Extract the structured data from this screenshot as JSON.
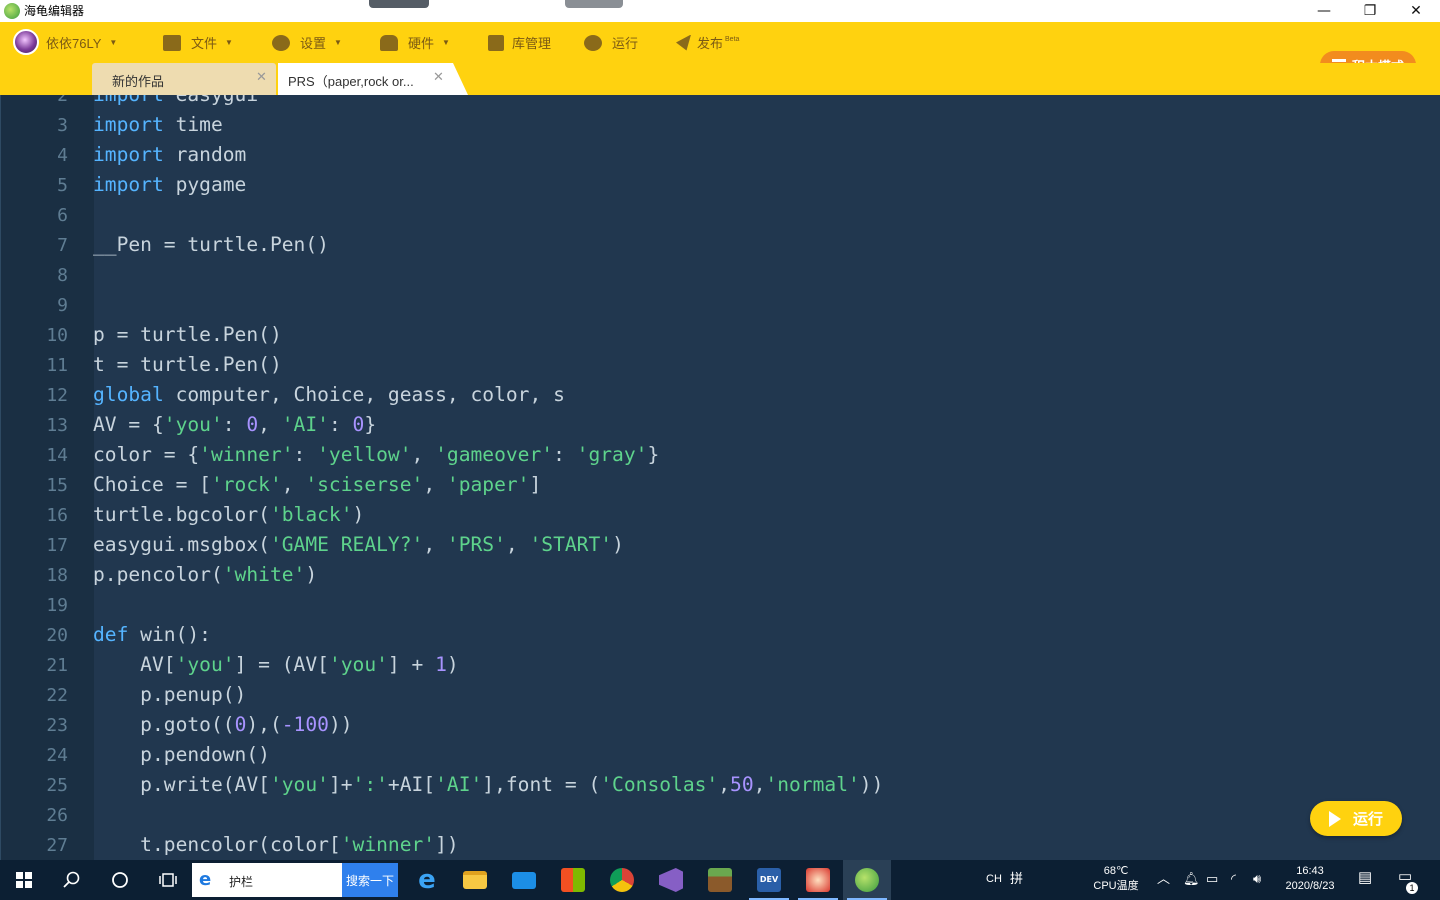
{
  "window": {
    "title": "海龟编辑器",
    "controls": {
      "minimize": "—",
      "maximize": "❐",
      "close": "✕"
    }
  },
  "menu": {
    "user": "依依76LY",
    "file": "文件",
    "settings": "设置",
    "hardware": "硬件",
    "library": "库管理",
    "run": "运行",
    "publish": "发布",
    "publish_badge": "Beta",
    "block_mode": "积木模式"
  },
  "tabs": [
    {
      "label": "新的作品",
      "close": "✕"
    },
    {
      "label": "PRS（paper,rock or...",
      "close": "✕"
    }
  ],
  "editor": {
    "lines": [
      {
        "no": "2",
        "tokens": [
          {
            "t": "import",
            "c": "kw"
          },
          {
            "t": " easygui",
            "c": ""
          }
        ]
      },
      {
        "no": "3",
        "tokens": [
          {
            "t": "import",
            "c": "kw"
          },
          {
            "t": " time",
            "c": ""
          }
        ]
      },
      {
        "no": "4",
        "tokens": [
          {
            "t": "import",
            "c": "kw"
          },
          {
            "t": " random",
            "c": ""
          }
        ]
      },
      {
        "no": "5",
        "tokens": [
          {
            "t": "import",
            "c": "kw"
          },
          {
            "t": " pygame",
            "c": ""
          }
        ]
      },
      {
        "no": "6",
        "tokens": []
      },
      {
        "no": "7",
        "tokens": [
          {
            "t": "__Pen = turtle.Pen()",
            "c": ""
          }
        ]
      },
      {
        "no": "8",
        "tokens": []
      },
      {
        "no": "9",
        "tokens": []
      },
      {
        "no": "10",
        "tokens": [
          {
            "t": "p = turtle.Pen()",
            "c": ""
          }
        ]
      },
      {
        "no": "11",
        "tokens": [
          {
            "t": "t = turtle.Pen()",
            "c": ""
          }
        ]
      },
      {
        "no": "12",
        "tokens": [
          {
            "t": "global",
            "c": "kw"
          },
          {
            "t": " computer, Choice, geass, color, s",
            "c": ""
          }
        ]
      },
      {
        "no": "13",
        "tokens": [
          {
            "t": "AV = {",
            "c": ""
          },
          {
            "t": "'you'",
            "c": "str"
          },
          {
            "t": ": ",
            "c": ""
          },
          {
            "t": "0",
            "c": "num"
          },
          {
            "t": ", ",
            "c": ""
          },
          {
            "t": "'AI'",
            "c": "str"
          },
          {
            "t": ": ",
            "c": ""
          },
          {
            "t": "0",
            "c": "num"
          },
          {
            "t": "}",
            "c": ""
          }
        ]
      },
      {
        "no": "14",
        "tokens": [
          {
            "t": "color = {",
            "c": ""
          },
          {
            "t": "'winner'",
            "c": "str"
          },
          {
            "t": ": ",
            "c": ""
          },
          {
            "t": "'yellow'",
            "c": "str"
          },
          {
            "t": ", ",
            "c": ""
          },
          {
            "t": "'gameover'",
            "c": "str"
          },
          {
            "t": ": ",
            "c": ""
          },
          {
            "t": "'gray'",
            "c": "str"
          },
          {
            "t": "}",
            "c": ""
          }
        ]
      },
      {
        "no": "15",
        "tokens": [
          {
            "t": "Choice = [",
            "c": ""
          },
          {
            "t": "'rock'",
            "c": "str"
          },
          {
            "t": ", ",
            "c": ""
          },
          {
            "t": "'sciserse'",
            "c": "str"
          },
          {
            "t": ", ",
            "c": ""
          },
          {
            "t": "'paper'",
            "c": "str"
          },
          {
            "t": "]",
            "c": ""
          }
        ]
      },
      {
        "no": "16",
        "tokens": [
          {
            "t": "turtle.bgcolor(",
            "c": ""
          },
          {
            "t": "'black'",
            "c": "str"
          },
          {
            "t": ")",
            "c": ""
          }
        ]
      },
      {
        "no": "17",
        "tokens": [
          {
            "t": "easygui.msgbox(",
            "c": ""
          },
          {
            "t": "'GAME REALY?'",
            "c": "str"
          },
          {
            "t": ", ",
            "c": ""
          },
          {
            "t": "'PRS'",
            "c": "str"
          },
          {
            "t": ", ",
            "c": ""
          },
          {
            "t": "'START'",
            "c": "str"
          },
          {
            "t": ")",
            "c": ""
          }
        ]
      },
      {
        "no": "18",
        "tokens": [
          {
            "t": "p.pencolor(",
            "c": ""
          },
          {
            "t": "'white'",
            "c": "str"
          },
          {
            "t": ")",
            "c": ""
          }
        ]
      },
      {
        "no": "19",
        "tokens": []
      },
      {
        "no": "20",
        "tokens": [
          {
            "t": "def",
            "c": "kw"
          },
          {
            "t": " win():",
            "c": ""
          }
        ]
      },
      {
        "no": "21",
        "tokens": [
          {
            "t": "    AV[",
            "c": ""
          },
          {
            "t": "'you'",
            "c": "str"
          },
          {
            "t": "] = (AV[",
            "c": ""
          },
          {
            "t": "'you'",
            "c": "str"
          },
          {
            "t": "] + ",
            "c": ""
          },
          {
            "t": "1",
            "c": "num"
          },
          {
            "t": ")",
            "c": ""
          }
        ]
      },
      {
        "no": "22",
        "tokens": [
          {
            "t": "    p.penup()",
            "c": ""
          }
        ]
      },
      {
        "no": "23",
        "tokens": [
          {
            "t": "    p.goto((",
            "c": ""
          },
          {
            "t": "0",
            "c": "num"
          },
          {
            "t": "),(",
            "c": ""
          },
          {
            "t": "-100",
            "c": "num"
          },
          {
            "t": "))",
            "c": ""
          }
        ]
      },
      {
        "no": "24",
        "tokens": [
          {
            "t": "    p.pendown()",
            "c": ""
          }
        ]
      },
      {
        "no": "25",
        "tokens": [
          {
            "t": "    p.write(AV[",
            "c": ""
          },
          {
            "t": "'you'",
            "c": "str"
          },
          {
            "t": "]+",
            "c": ""
          },
          {
            "t": "':'",
            "c": "str"
          },
          {
            "t": "+AI[",
            "c": ""
          },
          {
            "t": "'AI'",
            "c": "str"
          },
          {
            "t": "],font = (",
            "c": ""
          },
          {
            "t": "'Consolas'",
            "c": "str"
          },
          {
            "t": ",",
            "c": ""
          },
          {
            "t": "50",
            "c": "num"
          },
          {
            "t": ",",
            "c": ""
          },
          {
            "t": "'normal'",
            "c": "str"
          },
          {
            "t": "))",
            "c": ""
          }
        ]
      },
      {
        "no": "26",
        "tokens": []
      },
      {
        "no": "27",
        "tokens": [
          {
            "t": "    t.pencolor(color[",
            "c": ""
          },
          {
            "t": "'winner'",
            "c": "str"
          },
          {
            "t": "])",
            "c": ""
          }
        ]
      }
    ],
    "run_button": "运行"
  },
  "taskbar": {
    "search_label": "护栏",
    "search_button": "搜索一下",
    "ime": "CH",
    "ime_mode": "拼",
    "temp": "68℃",
    "temp_label": "CPU温度",
    "time": "16:43",
    "date": "2020/8/23",
    "notification_count": "1"
  }
}
